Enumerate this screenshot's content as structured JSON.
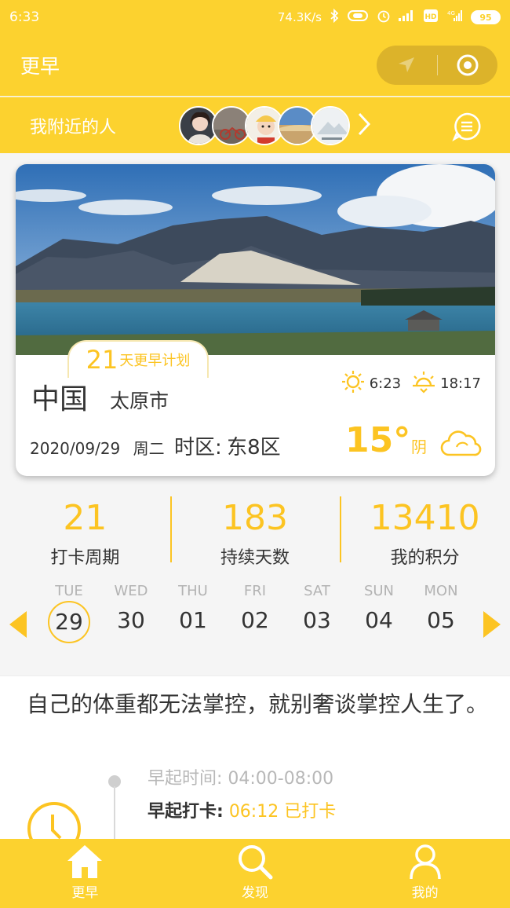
{
  "status": {
    "time": "6:33",
    "speed": "74.3K/s",
    "network": "4G",
    "battery": "95"
  },
  "app": {
    "title": "更早"
  },
  "nearby": {
    "label": "我附近的人"
  },
  "card": {
    "plan_num": "21",
    "plan_text": "天更早计划",
    "country": "中国",
    "city": "太原市",
    "sunrise": "6:23",
    "sunset": "18:17",
    "date": "2020/09/29",
    "weekday": "周二",
    "tz_label": "时区:",
    "tz_value": "东8区",
    "temp": "15°",
    "condition": "阴"
  },
  "stats": [
    {
      "value": "21",
      "label": "打卡周期"
    },
    {
      "value": "183",
      "label": "持续天数"
    },
    {
      "value": "13410",
      "label": "我的积分"
    }
  ],
  "week": [
    {
      "dow": "TUE",
      "day": "29",
      "selected": true
    },
    {
      "dow": "WED",
      "day": "30"
    },
    {
      "dow": "THU",
      "day": "01"
    },
    {
      "dow": "FRI",
      "day": "02"
    },
    {
      "dow": "SAT",
      "day": "03"
    },
    {
      "dow": "SUN",
      "day": "04"
    },
    {
      "dow": "MON",
      "day": "05"
    }
  ],
  "quote": "自己的体重都无法掌控，就别奢谈掌控人生了。",
  "wake": {
    "range": "早起时间: 04:00-08:00",
    "label": "早起打卡:",
    "time": "06:12 已打卡"
  },
  "tabs": [
    {
      "label": "更早",
      "icon": "home-icon"
    },
    {
      "label": "发现",
      "icon": "search-icon"
    },
    {
      "label": "我的",
      "icon": "user-icon"
    }
  ],
  "colors": {
    "brand": "#fcd22f",
    "accent": "#fcc422"
  }
}
